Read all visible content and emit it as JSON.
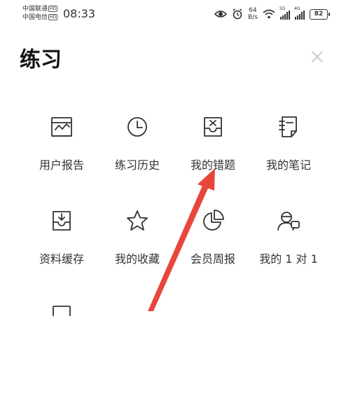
{
  "status_bar": {
    "carrier_1": "中国联通",
    "carrier_2": "中国电信",
    "hd_badge": "HD",
    "time": "08:33",
    "net_speed_value": "64",
    "net_speed_unit": "B/s",
    "signal_1_tag": "5G",
    "signal_2_tag": "4G",
    "battery": "82"
  },
  "header": {
    "title": "练习"
  },
  "tiles": [
    {
      "label": "用户报告",
      "icon": "report-icon"
    },
    {
      "label": "练习历史",
      "icon": "history-clock-icon"
    },
    {
      "label": "我的错题",
      "icon": "wrong-questions-tray-icon"
    },
    {
      "label": "我的笔记",
      "icon": "notes-icon"
    },
    {
      "label": "资料缓存",
      "icon": "download-tray-icon"
    },
    {
      "label": "我的收藏",
      "icon": "star-icon"
    },
    {
      "label": "会员周报",
      "icon": "pie-chart-icon"
    },
    {
      "label": "我的 1 对 1",
      "icon": "tutor-avatar-icon"
    }
  ],
  "colors": {
    "arrow": "#e8463d",
    "icon_stroke": "#333333"
  }
}
